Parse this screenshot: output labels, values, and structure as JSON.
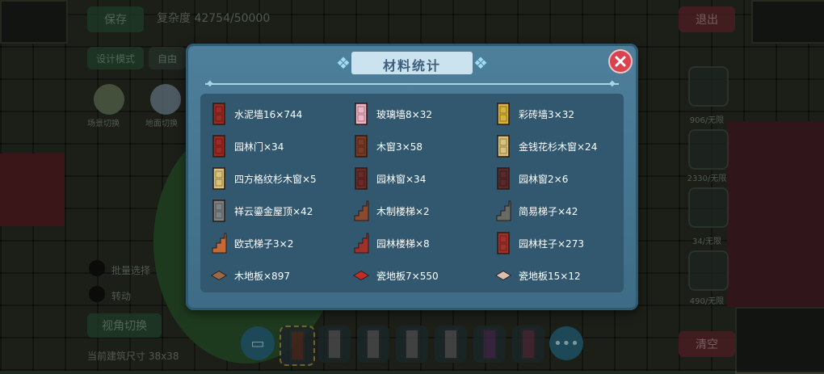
{
  "hud": {
    "save_label": "保存",
    "complexity_label": "复杂度 42754/50000",
    "design_mode_label": "设计模式",
    "free_mode_label": "自由",
    "exit_label": "退出",
    "clear_label": "清空",
    "switch_view_label": "视角切换",
    "current_size_label": "当前建筑尺寸 38x38",
    "multi_select_label": "批量选择",
    "rotate_label": "转动",
    "scene_switch_label": "场景切换",
    "ground_switch_label": "地面切换",
    "side_slots": [
      {
        "label": "906/无限"
      },
      {
        "label": "2330/无限"
      },
      {
        "label": "34/无限"
      },
      {
        "label": "490/无限"
      }
    ]
  },
  "modal": {
    "title": "材料统计",
    "items": [
      {
        "label": "水泥墙16×744",
        "icon": "cement-wall-icon",
        "color": "#9a2a22"
      },
      {
        "label": "玻璃墙8×32",
        "icon": "glass-wall-icon",
        "color": "#f1b4c6"
      },
      {
        "label": "彩砖墙3×32",
        "icon": "color-brick-wall-icon",
        "color": "#d8b33a"
      },
      {
        "label": "园林门×34",
        "icon": "garden-door-icon",
        "color": "#9a2a22"
      },
      {
        "label": "木窗3×58",
        "icon": "wood-window-icon",
        "color": "#7a3a26"
      },
      {
        "label": "金钱花杉木窗×24",
        "icon": "fir-window-icon",
        "color": "#d9c37a"
      },
      {
        "label": "四方格纹杉木窗×5",
        "icon": "lattice-window-icon",
        "color": "#d9c37a"
      },
      {
        "label": "园林窗×34",
        "icon": "garden-window-icon",
        "color": "#6b2a2a"
      },
      {
        "label": "园林窗2×6",
        "icon": "garden-window-2-icon",
        "color": "#5a2a2a"
      },
      {
        "label": "祥云鎏金屋顶×42",
        "icon": "golden-roof-icon",
        "color": "#7e8286"
      },
      {
        "label": "木制楼梯×2",
        "icon": "wood-stairs-icon",
        "color": "#8a4a2e"
      },
      {
        "label": "简易梯子×42",
        "icon": "simple-ladder-icon",
        "color": "#6a6a64"
      },
      {
        "label": "欧式梯子3×2",
        "icon": "euro-ladder-icon",
        "color": "#c56a36"
      },
      {
        "label": "园林楼梯×8",
        "icon": "garden-stairs-icon",
        "color": "#a2302a"
      },
      {
        "label": "园林柱子×273",
        "icon": "garden-pillar-icon",
        "color": "#a2302a"
      },
      {
        "label": "木地板×897",
        "icon": "wood-floor-icon",
        "color": "#9a6a48"
      },
      {
        "label": "瓷地板7×550",
        "icon": "tile-floor-icon",
        "color": "#c62a26"
      },
      {
        "label": "瓷地板15×12",
        "icon": "tile-floor-2-icon",
        "color": "#d8c0b0"
      }
    ]
  }
}
